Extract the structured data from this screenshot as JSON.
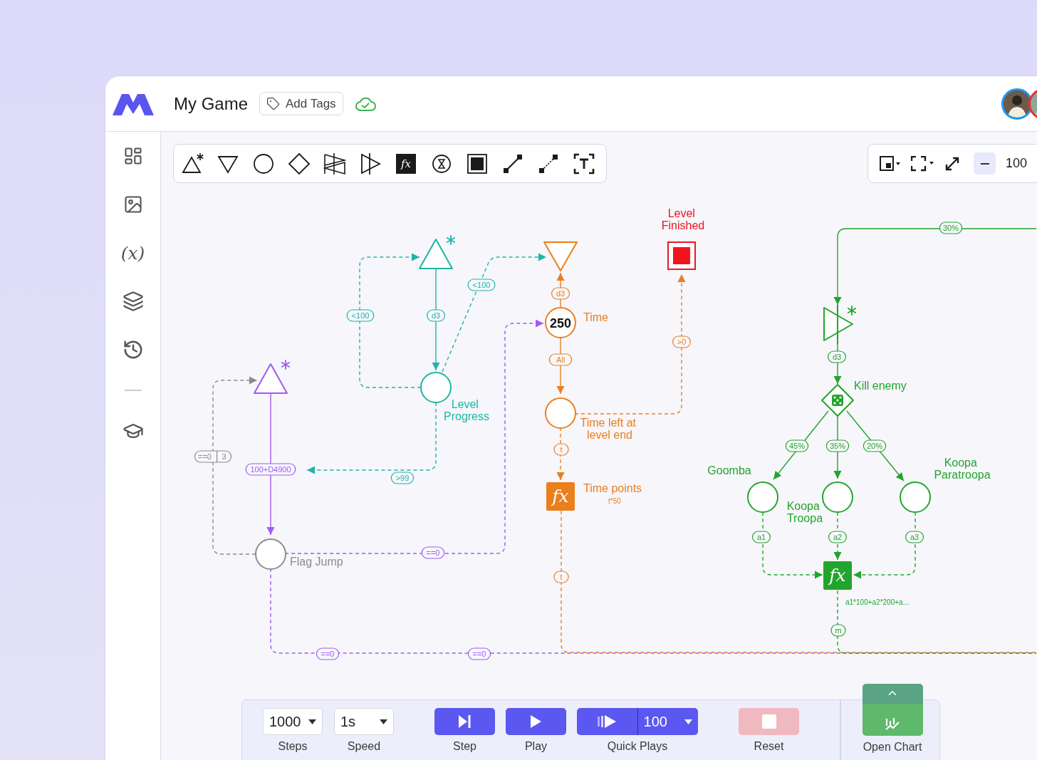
{
  "header": {
    "title": "My Game",
    "add_tags": "Add Tags"
  },
  "sidebar": [
    {
      "kind": "dashboard"
    },
    {
      "kind": "media"
    },
    {
      "kind": "variables",
      "label": "(x)"
    },
    {
      "kind": "layers"
    },
    {
      "kind": "history"
    },
    {
      "kind": "separator"
    },
    {
      "kind": "learn"
    }
  ],
  "tools": [
    {
      "kind": "source"
    },
    {
      "kind": "drain"
    },
    {
      "kind": "pool"
    },
    {
      "kind": "gate"
    },
    {
      "kind": "trader"
    },
    {
      "kind": "converter"
    },
    {
      "kind": "register",
      "label": "fx"
    },
    {
      "kind": "delay"
    },
    {
      "kind": "end"
    },
    {
      "kind": "resource_connection"
    },
    {
      "kind": "state_connection"
    },
    {
      "kind": "text"
    }
  ],
  "zoom": {
    "value": "100"
  },
  "diagram": {
    "nodes": [
      {
        "kind": "source",
        "starred": true
      },
      {
        "kind": "pool",
        "label": "Flag Jump"
      },
      {
        "kind": "source",
        "starred": true
      },
      {
        "kind": "pool",
        "label": "Level Progress"
      },
      {
        "kind": "drain"
      },
      {
        "kind": "pool",
        "label": "Time",
        "value": "250"
      },
      {
        "kind": "pool",
        "label": "Time left at level end"
      },
      {
        "kind": "register",
        "label": "Time points",
        "symbol": "fx",
        "formula": "t*50"
      },
      {
        "kind": "end",
        "label": "Level Finished"
      },
      {
        "kind": "trigger",
        "starred": true
      },
      {
        "kind": "random_gate",
        "label": "Kill enemy"
      },
      {
        "kind": "pool",
        "label": "Goomba"
      },
      {
        "kind": "pool",
        "label": "Koopa Troopa"
      },
      {
        "kind": "pool",
        "label": "Koopa Paratroopa"
      },
      {
        "kind": "register",
        "symbol": "fx",
        "formula": "a1*100+a2*200+a..."
      }
    ],
    "connections": [
      {
        "labels": [
          "100+D4900"
        ]
      },
      {
        "labels": [
          "==0",
          "3"
        ]
      },
      {
        "labels": [
          "<100"
        ]
      },
      {
        "labels": [
          "d3"
        ]
      },
      {
        "labels": [
          "<100"
        ]
      },
      {
        "labels": [
          ">99"
        ]
      },
      {
        "labels": [
          "==0"
        ]
      },
      {
        "labels": [
          "d3"
        ]
      },
      {
        "labels": [
          "All"
        ]
      },
      {
        "labels": [
          ">0"
        ]
      },
      {
        "labels": [
          "t"
        ]
      },
      {
        "labels": [
          "t"
        ]
      },
      {
        "labels": [
          "==0",
          "==0"
        ]
      },
      {
        "labels": [
          "30%"
        ]
      },
      {
        "labels": [
          "d3"
        ]
      },
      {
        "labels": [
          "45%"
        ]
      },
      {
        "labels": [
          "35%"
        ]
      },
      {
        "labels": [
          "20%"
        ]
      },
      {
        "labels": [
          "a1"
        ]
      },
      {
        "labels": [
          "a2"
        ]
      },
      {
        "labels": [
          "a3"
        ]
      },
      {
        "labels": [
          "m"
        ]
      }
    ]
  },
  "controls": {
    "steps": {
      "value": "1000",
      "label": "Steps"
    },
    "speed": {
      "value": "1s",
      "label": "Speed"
    },
    "buttons": [
      {
        "kind": "step",
        "label": "Step"
      },
      {
        "kind": "play",
        "label": "Play"
      },
      {
        "kind": "quick",
        "label": "Quick Plays",
        "count": "100"
      },
      {
        "kind": "reset",
        "label": "Reset",
        "disabled": true
      }
    ],
    "chart": {
      "label": "Open Chart"
    }
  }
}
